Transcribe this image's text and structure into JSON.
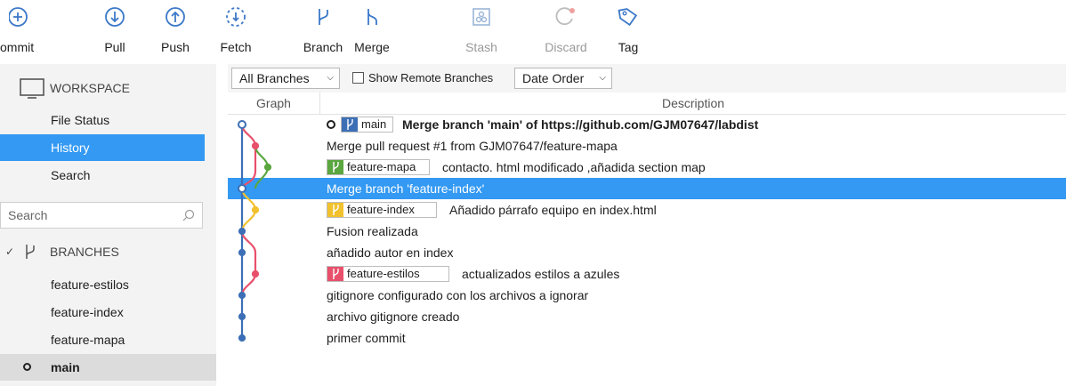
{
  "toolbar": {
    "buttons": [
      {
        "label": "ommit",
        "icon": "plus-circle-icon",
        "enabled": true
      },
      {
        "label": "Pull",
        "icon": "arrow-down-circle-icon",
        "enabled": true
      },
      {
        "label": "Push",
        "icon": "arrow-up-circle-icon",
        "enabled": true
      },
      {
        "label": "Fetch",
        "icon": "fetch-dashed-circle-icon",
        "enabled": true
      },
      {
        "label": "Branch",
        "icon": "branch-icon",
        "enabled": true
      },
      {
        "label": "Merge",
        "icon": "merge-icon",
        "enabled": true
      },
      {
        "label": "Stash",
        "icon": "stash-icon",
        "enabled": false
      },
      {
        "label": "Discard",
        "icon": "discard-icon",
        "enabled": false
      },
      {
        "label": "Tag",
        "icon": "tag-icon",
        "enabled": true
      }
    ]
  },
  "sidebar": {
    "workspace_label": "WORKSPACE",
    "items": [
      {
        "label": "File Status",
        "selected": false
      },
      {
        "label": "History",
        "selected": true
      },
      {
        "label": "Search",
        "selected": false
      }
    ],
    "search_placeholder": "Search",
    "branches_label": "BRANCHES",
    "branches": [
      {
        "name": "feature-estilos",
        "current": false
      },
      {
        "name": "feature-index",
        "current": false
      },
      {
        "name": "feature-mapa",
        "current": false
      },
      {
        "name": "main",
        "current": true
      }
    ]
  },
  "filterbar": {
    "branches_filter": "All Branches",
    "show_remote_label": "Show Remote Branches",
    "show_remote_checked": false,
    "order": "Date Order"
  },
  "columns": {
    "graph": "Graph",
    "description": "Description"
  },
  "colors": {
    "accent": "#3399f3",
    "main": "#3c6fb6",
    "feature_mapa": "#5aa63f",
    "feature_index": "#f2c12e",
    "feature_estilos": "#e8506b"
  },
  "commits": [
    {
      "message": "Merge branch 'main' of https://github.com/GJM07647/labdist",
      "branch_label": "main",
      "branch_color": "#3c6fb6",
      "is_head": true,
      "bold": true,
      "selected": false
    },
    {
      "message": "Merge pull request #1 from GJM07647/feature-mapa",
      "branch_label": "",
      "selected": false
    },
    {
      "message": "contacto. html modificado ,añadida section map",
      "branch_label": "feature-mapa",
      "branch_color": "#5aa63f",
      "selected": false
    },
    {
      "message": "Merge branch 'feature-index'",
      "branch_label": "",
      "selected": true
    },
    {
      "message": "Añadido párrafo equipo en index.html",
      "branch_label": "feature-index",
      "branch_color": "#f2c12e",
      "selected": false
    },
    {
      "message": "Fusion realizada",
      "branch_label": "",
      "selected": false
    },
    {
      "message": "añadido autor en index",
      "branch_label": "",
      "selected": false
    },
    {
      "message": "actualizados estilos a azules",
      "branch_label": "feature-estilos",
      "branch_color": "#e8506b",
      "selected": false
    },
    {
      "message": "gitignore configurado con los archivos a ignorar",
      "branch_label": "",
      "selected": false
    },
    {
      "message": "archivo gitignore creado",
      "branch_label": "",
      "selected": false
    },
    {
      "message": "primer commit",
      "branch_label": "",
      "selected": false
    }
  ]
}
